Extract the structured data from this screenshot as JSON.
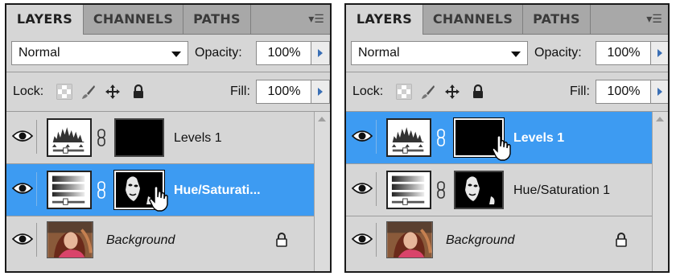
{
  "panels": [
    {
      "tabs": [
        {
          "label": "LAYERS",
          "active": true
        },
        {
          "label": "CHANNELS",
          "active": false
        },
        {
          "label": "PATHS",
          "active": false
        }
      ],
      "menu_icon": "panel-menu-icon",
      "blend_mode": "Normal",
      "opacity_label": "Opacity:",
      "opacity_value": "100%",
      "lock_label": "Lock:",
      "fill_label": "Fill:",
      "fill_value": "100%",
      "layers": [
        {
          "name": "Levels 1",
          "type": "levels-adjustment",
          "selected": false
        },
        {
          "name": "Hue/Saturati...",
          "type": "hue-saturation-adjustment",
          "selected": true
        },
        {
          "name": "Background",
          "type": "image",
          "locked": true,
          "selected": false
        }
      ]
    },
    {
      "tabs": [
        {
          "label": "LAYERS",
          "active": true
        },
        {
          "label": "CHANNELS",
          "active": false
        },
        {
          "label": "PATHS",
          "active": false
        }
      ],
      "menu_icon": "panel-menu-icon",
      "blend_mode": "Normal",
      "opacity_label": "Opacity:",
      "opacity_value": "100%",
      "lock_label": "Lock:",
      "fill_label": "Fill:",
      "fill_value": "100%",
      "layers": [
        {
          "name": "Levels 1",
          "type": "levels-adjustment",
          "selected": true
        },
        {
          "name": "Hue/Saturation 1",
          "type": "hue-saturation-adjustment",
          "selected": false
        },
        {
          "name": "Background",
          "type": "image",
          "locked": true,
          "selected": false
        }
      ]
    }
  ],
  "colors": {
    "panel_bg": "#d6d6d6",
    "tab_bar": "#a8a8a8",
    "selection": "#3d9bf2",
    "arrow_accent": "#3a6fb5"
  }
}
